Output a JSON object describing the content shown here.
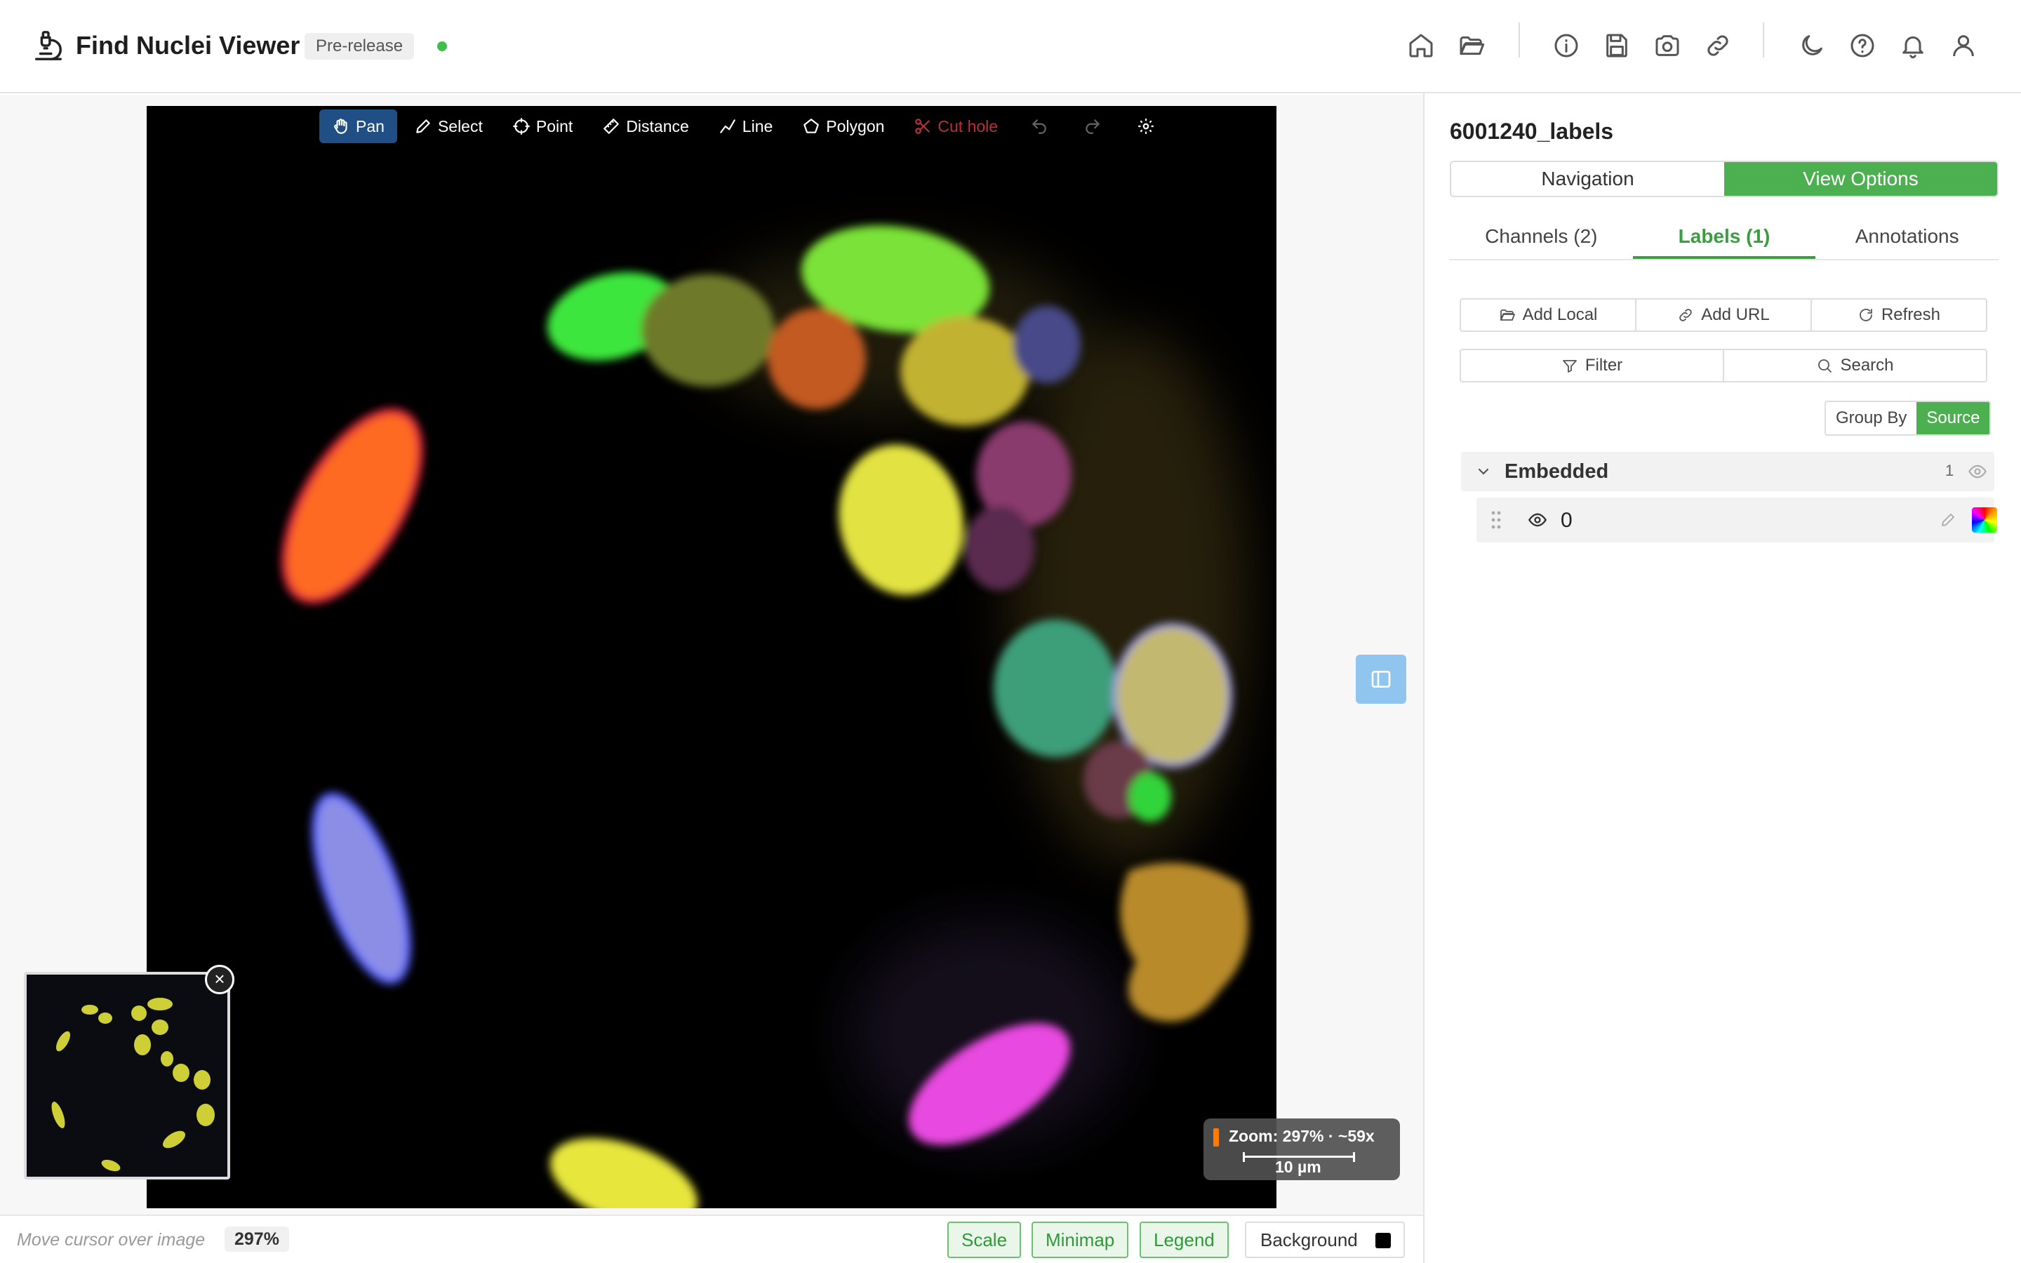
{
  "header": {
    "title": "Find Nuclei Viewer",
    "badge": "Pre-release",
    "status_color": "#3fbf4a",
    "icons": [
      "home-icon",
      "folder-open-icon",
      "info-icon",
      "save-icon",
      "camera-icon",
      "link-icon",
      "moon-icon",
      "help-icon",
      "bell-icon",
      "user-icon"
    ]
  },
  "toolbar": {
    "pan": "Pan",
    "select": "Select",
    "point": "Point",
    "distance": "Distance",
    "line": "Line",
    "polygon": "Polygon",
    "cut_hole": "Cut hole"
  },
  "viewer": {
    "zoom_text": "Zoom: 297% · ~59x",
    "scale_label": "10 µm",
    "minimap_close": "×"
  },
  "bottombar": {
    "cursor_msg": "Move cursor over image",
    "zoom": "297%",
    "scale": "Scale",
    "minimap": "Minimap",
    "legend": "Legend",
    "background": "Background",
    "background_color": "#000000"
  },
  "panel": {
    "layer_title": "6001240_labels",
    "seg_navigation": "Navigation",
    "seg_view_options": "View Options",
    "tabs": [
      "Channels (2)",
      "Labels (1)",
      "Annotations"
    ],
    "add_local": "Add Local",
    "add_url": "Add URL",
    "refresh": "Refresh",
    "filter": "Filter",
    "search": "Search",
    "group_by": "Group By",
    "source": "Source",
    "group_name": "Embedded",
    "group_count": "1",
    "layer_name": "0"
  },
  "colors": {
    "accent": "#4caf50",
    "pan_active": "#1f4f84",
    "danger": "#b8323a",
    "zoom_marker": "#ff7a00"
  }
}
